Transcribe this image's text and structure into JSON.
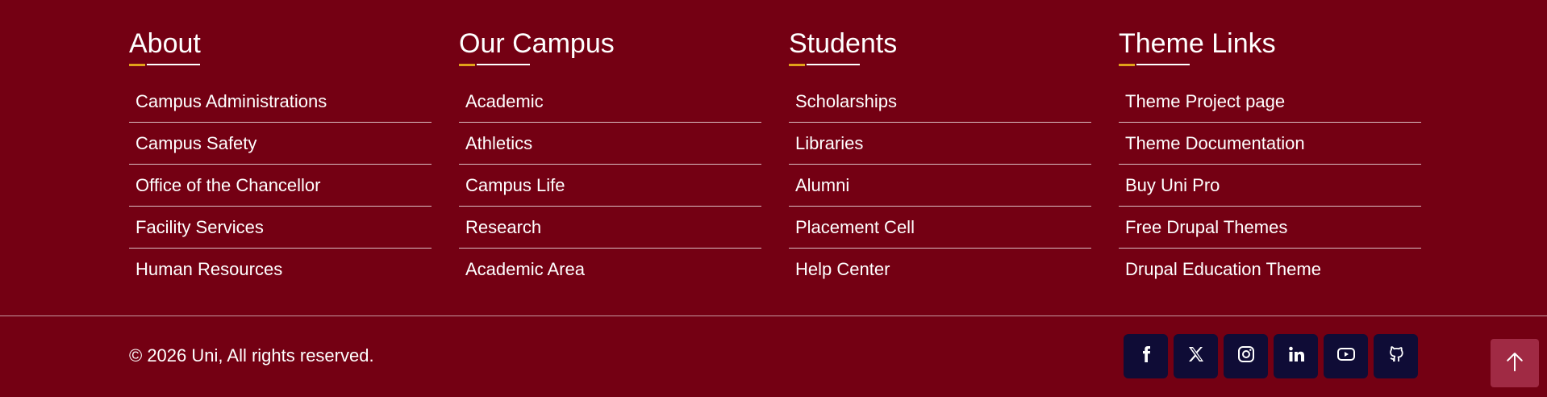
{
  "footer": {
    "columns": [
      {
        "title": "About",
        "links": [
          "Campus Administrations",
          "Campus Safety",
          "Office of the Chancellor",
          "Facility Services",
          "Human Resources"
        ]
      },
      {
        "title": "Our Campus",
        "links": [
          "Academic",
          "Athletics",
          "Campus Life",
          "Research",
          "Academic Area"
        ]
      },
      {
        "title": "Students",
        "links": [
          "Scholarships",
          "Libraries",
          "Alumni",
          "Placement Cell",
          "Help Center"
        ]
      },
      {
        "title": "Theme Links",
        "links": [
          "Theme Project page",
          "Theme Documentation",
          "Buy Uni Pro",
          "Free Drupal Themes",
          "Drupal Education Theme"
        ]
      }
    ],
    "copyright": "© 2026 Uni, All rights reserved.",
    "socials": [
      "facebook-icon",
      "x-icon",
      "instagram-icon",
      "linkedin-icon",
      "youtube-icon",
      "github-icon"
    ],
    "scroll_top_icon": "arrow-up-icon"
  },
  "colors": {
    "background": "#740013",
    "accent": "#e1a11a",
    "social_bg": "#0f0c36",
    "scroll_top_bg": "#a02a44"
  }
}
